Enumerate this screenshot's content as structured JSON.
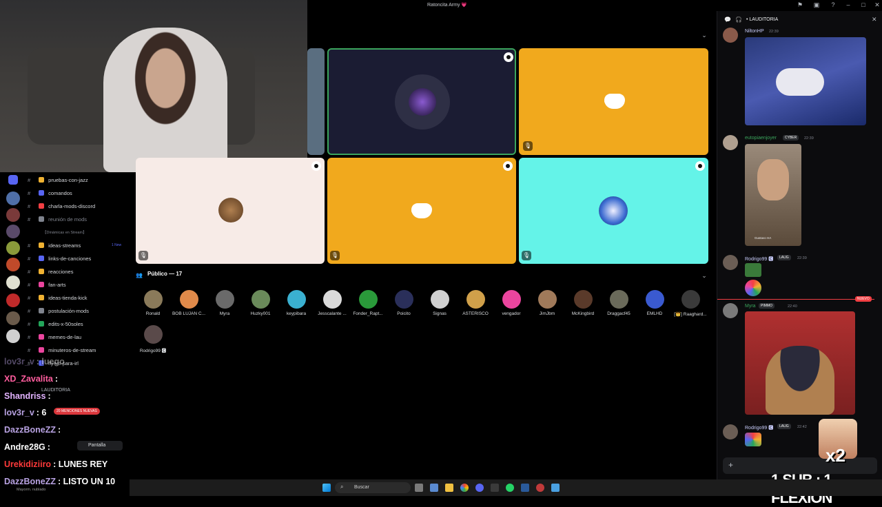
{
  "window": {
    "title": "Ratoncita Army 💗"
  },
  "channels": [
    {
      "label": "pruebas-con-jazz",
      "color": "#f0b232"
    },
    {
      "label": "comandos",
      "color": "#5865f2"
    },
    {
      "label": "charla-mods-discord",
      "color": "#f23f43"
    },
    {
      "label": "reunión de mods",
      "color": "#80848e",
      "muted": true
    },
    {
      "label": "【Dinámicas en Stream】",
      "category": true
    },
    {
      "label": "ideas-streams",
      "color": "#f0b232",
      "badge": "1 New"
    },
    {
      "label": "links-de-canciones",
      "color": "#5865f2"
    },
    {
      "label": "reacciones",
      "color": "#f0b232"
    },
    {
      "label": "fan-arts",
      "color": "#eb459e"
    },
    {
      "label": "ideas-tienda-kick",
      "color": "#f0b232"
    },
    {
      "label": "postulación-mods",
      "color": "#80848e"
    },
    {
      "label": "edits-x-50soles",
      "color": "#23a55a"
    },
    {
      "label": "memes-de-lau",
      "color": "#eb459e"
    },
    {
      "label": "minuteros-de-stream",
      "color": "#eb459e"
    },
    {
      "label": "flyers-para-irl",
      "color": "#5865f2"
    }
  ],
  "voice_panel": {
    "channel": "LAUDITORIA",
    "mentions": "20 MENCIONES NUEVAS",
    "share_label": "Pantalla",
    "user_status": "Mayorm. nublado"
  },
  "audience": {
    "header": "Público — 17",
    "members": [
      {
        "name": "Ronald",
        "color": "#8a7a5a"
      },
      {
        "name": "BOB LUJAN C...",
        "color": "#e08a4a"
      },
      {
        "name": "Myra",
        "color": "#6a6a6a"
      },
      {
        "name": "Huzky001",
        "color": "#6a8a5a"
      },
      {
        "name": "keypibara",
        "color": "#3ab0d0"
      },
      {
        "name": "Jesscalante ...",
        "color": "#dadada"
      },
      {
        "name": "Fonder_Rapt...",
        "color": "#2a9a3a"
      },
      {
        "name": "Poicito",
        "color": "#2a2f5a"
      },
      {
        "name": "Signas",
        "color": "#d0d0d0"
      },
      {
        "name": "ASTERISCO",
        "color": "#d0a04a"
      },
      {
        "name": "vengador",
        "color": "#eb459e"
      },
      {
        "name": "JimJbm",
        "color": "#a07a5a"
      },
      {
        "name": "McKingbird",
        "color": "#5a3a2a"
      },
      {
        "name": "Draggacf45",
        "color": "#6a6a5a"
      },
      {
        "name": "EMLHD",
        "color": "#3a5ad0"
      },
      {
        "name": "[👑] Raaghard...",
        "color": "#3a3a3a"
      },
      {
        "name": "Rodrigo99 🅲",
        "color": "#5a4a4a"
      }
    ]
  },
  "chat_panel": {
    "title": "LAUDITORIA",
    "messages": [
      {
        "name": "NiltonHP",
        "time": "22:39",
        "color": "#c9cdfb"
      },
      {
        "name": "eutopiaenjoyer",
        "badge": "CYBER",
        "time": "22:39",
        "color": "#3ba55d"
      },
      {
        "name": "Rodrigo99 🅲",
        "badge": "LAUG",
        "time": "22:39",
        "color": "#c9cdfb"
      },
      {
        "name": "Myra",
        "badge": "PIMMO",
        "time": "22:40",
        "color": "#3ba55d",
        "new_label": "NUEVO"
      },
      {
        "name": "Rodrigo99 🅲",
        "badge": "LAUG",
        "time": "22:42",
        "color": "#c9cdfb"
      }
    ],
    "video_caption": "Gustavo HA"
  },
  "overlay_chat": [
    {
      "user": "lov3r_v",
      "text": ": luego",
      "color": "#b9a3e3",
      "faded": true
    },
    {
      "user": "XD_Zavalita",
      "text": ":",
      "color": "#ff5d9e"
    },
    {
      "user": "Shandriss",
      "text": ":",
      "color": "#e3b3ff"
    },
    {
      "user": "lov3r_v",
      "text": ": 6",
      "color": "#b9a3e3"
    },
    {
      "user": "DazzBoneZZ",
      "text": ":",
      "color": "#b9a3e3"
    },
    {
      "user": "Andre28G",
      "text": ":",
      "color": "#ffffff"
    },
    {
      "user": "Urekidiziiro",
      "text": ": LUNES REY",
      "color": "#ff3a3a"
    },
    {
      "user": "DazzBoneZZ",
      "text": ": LISTO UN 10",
      "color": "#b9a3e3"
    }
  ],
  "promo": {
    "multiplier": "x2",
    "text": "1 SUB : 1 FLEXIÓN"
  },
  "taskbar": {
    "search_placeholder": "Buscar"
  },
  "colors": {
    "tile_orange": "#f1a91d",
    "tile_cyan": "#64f3e8",
    "tile_cream": "#f7ebe7",
    "tile_navy": "#1b1c33",
    "speaking_border": "#3ba55d"
  }
}
